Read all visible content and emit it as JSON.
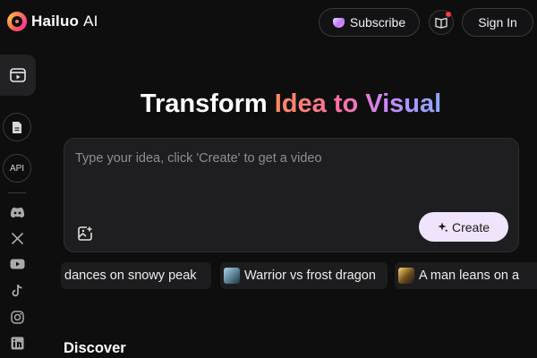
{
  "header": {
    "brand_name": "Hailuo",
    "brand_suffix": "AI",
    "subscribe_label": "Subscribe",
    "signin_label": "Sign In"
  },
  "sidebar": {
    "api_label": "API",
    "socials": [
      "discord-icon",
      "x-icon",
      "youtube-icon",
      "tiktok-icon",
      "instagram-icon",
      "linkedin-icon"
    ]
  },
  "hero": {
    "title_lead": "Transform",
    "title_highlight": "Idea to Visual"
  },
  "prompt": {
    "placeholder": "Type your idea, click 'Create' to get a video",
    "value": "",
    "create_label": "Create"
  },
  "suggestions": [
    {
      "label": "dances on snowy peak"
    },
    {
      "label": "Warrior vs frost dragon"
    },
    {
      "label": "A man leans on a"
    }
  ],
  "discover_label": "Discover",
  "colors": {
    "background": "#0e0e0f",
    "create_button": "#efe4fc",
    "title_gradient": [
      "#ff8a5c",
      "#ff6fa6",
      "#c48bff",
      "#8aa8ff"
    ],
    "notification_dot": "#ff3b3b"
  }
}
